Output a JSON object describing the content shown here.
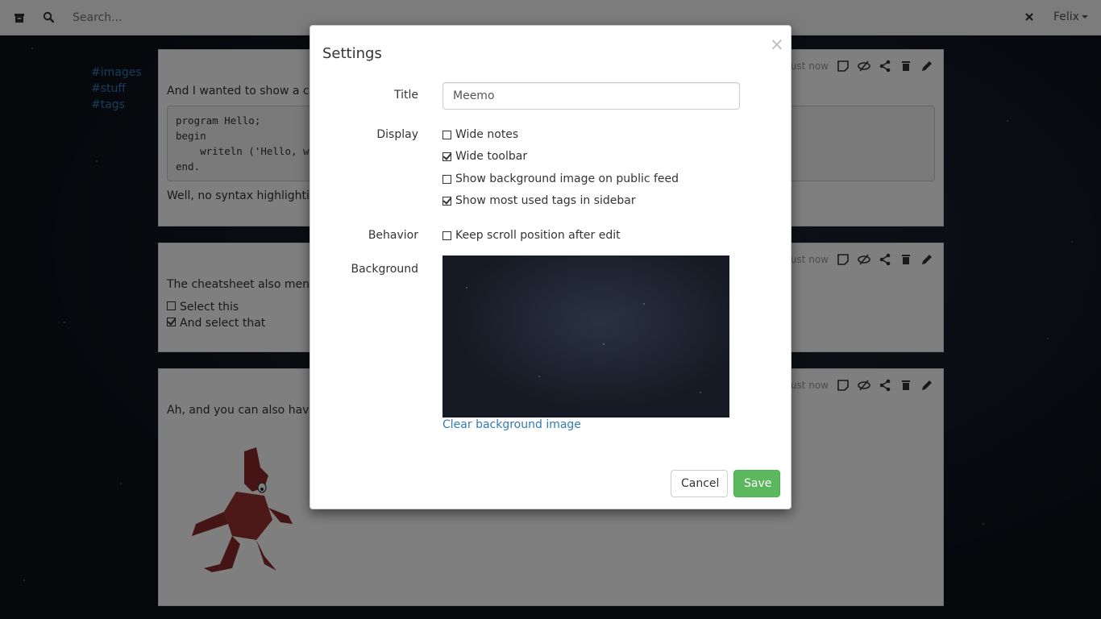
{
  "navbar": {
    "search_placeholder": "Search...",
    "user_name": "Felix"
  },
  "sidebar": {
    "tags": [
      "#images",
      "#stuff",
      "#tags"
    ]
  },
  "notes": [
    {
      "timestamp": "just now",
      "text_intro": "And I wanted to show a co",
      "code": "program Hello;\nbegin\n    writeln ('Hello, w\nend.",
      "text_outro": "Well, no syntax highlighting"
    },
    {
      "timestamp": "just now",
      "text_intro": "The cheatsheet also mentio",
      "checklist": [
        {
          "label": "Select this",
          "checked": false
        },
        {
          "label": "And select that",
          "checked": true
        }
      ]
    },
    {
      "timestamp": "just now",
      "text_intro": "Ah, and you can also have",
      "image_alt": "coyote"
    }
  ],
  "modal": {
    "title": "Settings",
    "close_glyph": "×",
    "title_label": "Title",
    "title_value": "Meemo",
    "display_label": "Display",
    "display_options": [
      {
        "label": "Wide notes",
        "checked": false
      },
      {
        "label": "Wide toolbar",
        "checked": true
      },
      {
        "label": "Show background image on public feed",
        "checked": false
      },
      {
        "label": "Show most used tags in sidebar",
        "checked": true
      }
    ],
    "behavior_label": "Behavior",
    "behavior_options": [
      {
        "label": "Keep scroll position after edit",
        "checked": false
      }
    ],
    "background_label": "Background",
    "clear_background_label": "Clear background image",
    "cancel_label": "Cancel",
    "save_label": "Save"
  },
  "colors": {
    "link": "#337ab7",
    "save_button": "#5cb85c"
  }
}
